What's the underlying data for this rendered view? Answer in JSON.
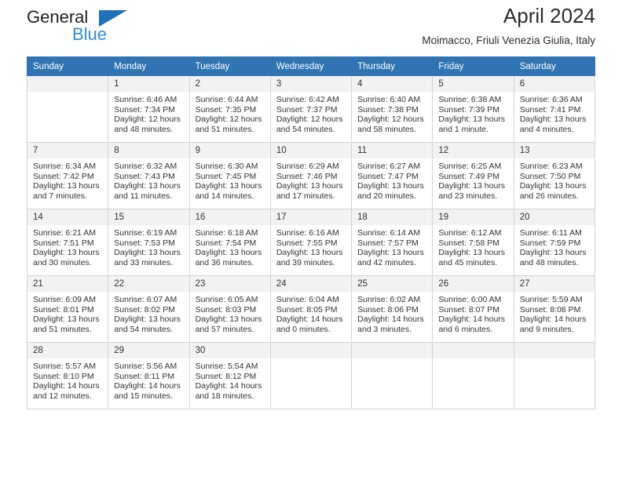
{
  "brand": {
    "name_top": "General",
    "name_bottom": "Blue",
    "triangle_color": "#1f71b8",
    "text_color_top": "#231f20",
    "text_color_bottom": "#2f8fd6"
  },
  "header": {
    "title": "April 2024",
    "subtitle": "Moimacco, Friuli Venezia Giulia, Italy"
  },
  "colors": {
    "header_row_bg": "#3174b4",
    "header_row_text": "#ffffff",
    "daynum_bg": "#f2f2f2",
    "cell_border": "#d4d4d4",
    "body_text": "#333333"
  },
  "weekdays": [
    "Sunday",
    "Monday",
    "Tuesday",
    "Wednesday",
    "Thursday",
    "Friday",
    "Saturday"
  ],
  "weeks": [
    [
      {
        "day": "",
        "sunrise": "",
        "sunset": "",
        "daylight_line1": "",
        "daylight_line2": ""
      },
      {
        "day": "1",
        "sunrise": "Sunrise: 6:46 AM",
        "sunset": "Sunset: 7:34 PM",
        "daylight_line1": "Daylight: 12 hours",
        "daylight_line2": "and 48 minutes."
      },
      {
        "day": "2",
        "sunrise": "Sunrise: 6:44 AM",
        "sunset": "Sunset: 7:35 PM",
        "daylight_line1": "Daylight: 12 hours",
        "daylight_line2": "and 51 minutes."
      },
      {
        "day": "3",
        "sunrise": "Sunrise: 6:42 AM",
        "sunset": "Sunset: 7:37 PM",
        "daylight_line1": "Daylight: 12 hours",
        "daylight_line2": "and 54 minutes."
      },
      {
        "day": "4",
        "sunrise": "Sunrise: 6:40 AM",
        "sunset": "Sunset: 7:38 PM",
        "daylight_line1": "Daylight: 12 hours",
        "daylight_line2": "and 58 minutes."
      },
      {
        "day": "5",
        "sunrise": "Sunrise: 6:38 AM",
        "sunset": "Sunset: 7:39 PM",
        "daylight_line1": "Daylight: 13 hours",
        "daylight_line2": "and 1 minute."
      },
      {
        "day": "6",
        "sunrise": "Sunrise: 6:36 AM",
        "sunset": "Sunset: 7:41 PM",
        "daylight_line1": "Daylight: 13 hours",
        "daylight_line2": "and 4 minutes."
      }
    ],
    [
      {
        "day": "7",
        "sunrise": "Sunrise: 6:34 AM",
        "sunset": "Sunset: 7:42 PM",
        "daylight_line1": "Daylight: 13 hours",
        "daylight_line2": "and 7 minutes."
      },
      {
        "day": "8",
        "sunrise": "Sunrise: 6:32 AM",
        "sunset": "Sunset: 7:43 PM",
        "daylight_line1": "Daylight: 13 hours",
        "daylight_line2": "and 11 minutes."
      },
      {
        "day": "9",
        "sunrise": "Sunrise: 6:30 AM",
        "sunset": "Sunset: 7:45 PM",
        "daylight_line1": "Daylight: 13 hours",
        "daylight_line2": "and 14 minutes."
      },
      {
        "day": "10",
        "sunrise": "Sunrise: 6:29 AM",
        "sunset": "Sunset: 7:46 PM",
        "daylight_line1": "Daylight: 13 hours",
        "daylight_line2": "and 17 minutes."
      },
      {
        "day": "11",
        "sunrise": "Sunrise: 6:27 AM",
        "sunset": "Sunset: 7:47 PM",
        "daylight_line1": "Daylight: 13 hours",
        "daylight_line2": "and 20 minutes."
      },
      {
        "day": "12",
        "sunrise": "Sunrise: 6:25 AM",
        "sunset": "Sunset: 7:49 PM",
        "daylight_line1": "Daylight: 13 hours",
        "daylight_line2": "and 23 minutes."
      },
      {
        "day": "13",
        "sunrise": "Sunrise: 6:23 AM",
        "sunset": "Sunset: 7:50 PM",
        "daylight_line1": "Daylight: 13 hours",
        "daylight_line2": "and 26 minutes."
      }
    ],
    [
      {
        "day": "14",
        "sunrise": "Sunrise: 6:21 AM",
        "sunset": "Sunset: 7:51 PM",
        "daylight_line1": "Daylight: 13 hours",
        "daylight_line2": "and 30 minutes."
      },
      {
        "day": "15",
        "sunrise": "Sunrise: 6:19 AM",
        "sunset": "Sunset: 7:53 PM",
        "daylight_line1": "Daylight: 13 hours",
        "daylight_line2": "and 33 minutes."
      },
      {
        "day": "16",
        "sunrise": "Sunrise: 6:18 AM",
        "sunset": "Sunset: 7:54 PM",
        "daylight_line1": "Daylight: 13 hours",
        "daylight_line2": "and 36 minutes."
      },
      {
        "day": "17",
        "sunrise": "Sunrise: 6:16 AM",
        "sunset": "Sunset: 7:55 PM",
        "daylight_line1": "Daylight: 13 hours",
        "daylight_line2": "and 39 minutes."
      },
      {
        "day": "18",
        "sunrise": "Sunrise: 6:14 AM",
        "sunset": "Sunset: 7:57 PM",
        "daylight_line1": "Daylight: 13 hours",
        "daylight_line2": "and 42 minutes."
      },
      {
        "day": "19",
        "sunrise": "Sunrise: 6:12 AM",
        "sunset": "Sunset: 7:58 PM",
        "daylight_line1": "Daylight: 13 hours",
        "daylight_line2": "and 45 minutes."
      },
      {
        "day": "20",
        "sunrise": "Sunrise: 6:11 AM",
        "sunset": "Sunset: 7:59 PM",
        "daylight_line1": "Daylight: 13 hours",
        "daylight_line2": "and 48 minutes."
      }
    ],
    [
      {
        "day": "21",
        "sunrise": "Sunrise: 6:09 AM",
        "sunset": "Sunset: 8:01 PM",
        "daylight_line1": "Daylight: 13 hours",
        "daylight_line2": "and 51 minutes."
      },
      {
        "day": "22",
        "sunrise": "Sunrise: 6:07 AM",
        "sunset": "Sunset: 8:02 PM",
        "daylight_line1": "Daylight: 13 hours",
        "daylight_line2": "and 54 minutes."
      },
      {
        "day": "23",
        "sunrise": "Sunrise: 6:05 AM",
        "sunset": "Sunset: 8:03 PM",
        "daylight_line1": "Daylight: 13 hours",
        "daylight_line2": "and 57 minutes."
      },
      {
        "day": "24",
        "sunrise": "Sunrise: 6:04 AM",
        "sunset": "Sunset: 8:05 PM",
        "daylight_line1": "Daylight: 14 hours",
        "daylight_line2": "and 0 minutes."
      },
      {
        "day": "25",
        "sunrise": "Sunrise: 6:02 AM",
        "sunset": "Sunset: 8:06 PM",
        "daylight_line1": "Daylight: 14 hours",
        "daylight_line2": "and 3 minutes."
      },
      {
        "day": "26",
        "sunrise": "Sunrise: 6:00 AM",
        "sunset": "Sunset: 8:07 PM",
        "daylight_line1": "Daylight: 14 hours",
        "daylight_line2": "and 6 minutes."
      },
      {
        "day": "27",
        "sunrise": "Sunrise: 5:59 AM",
        "sunset": "Sunset: 8:08 PM",
        "daylight_line1": "Daylight: 14 hours",
        "daylight_line2": "and 9 minutes."
      }
    ],
    [
      {
        "day": "28",
        "sunrise": "Sunrise: 5:57 AM",
        "sunset": "Sunset: 8:10 PM",
        "daylight_line1": "Daylight: 14 hours",
        "daylight_line2": "and 12 minutes."
      },
      {
        "day": "29",
        "sunrise": "Sunrise: 5:56 AM",
        "sunset": "Sunset: 8:11 PM",
        "daylight_line1": "Daylight: 14 hours",
        "daylight_line2": "and 15 minutes."
      },
      {
        "day": "30",
        "sunrise": "Sunrise: 5:54 AM",
        "sunset": "Sunset: 8:12 PM",
        "daylight_line1": "Daylight: 14 hours",
        "daylight_line2": "and 18 minutes."
      },
      {
        "day": "",
        "sunrise": "",
        "sunset": "",
        "daylight_line1": "",
        "daylight_line2": ""
      },
      {
        "day": "",
        "sunrise": "",
        "sunset": "",
        "daylight_line1": "",
        "daylight_line2": ""
      },
      {
        "day": "",
        "sunrise": "",
        "sunset": "",
        "daylight_line1": "",
        "daylight_line2": ""
      },
      {
        "day": "",
        "sunrise": "",
        "sunset": "",
        "daylight_line1": "",
        "daylight_line2": ""
      }
    ]
  ]
}
